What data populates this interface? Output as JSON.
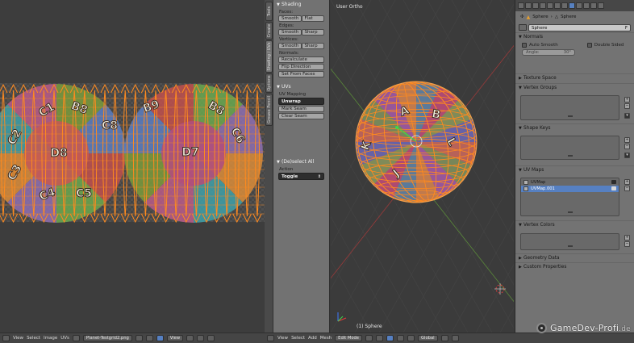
{
  "uv_editor": {
    "labels": [
      "C1",
      "B8",
      "C2",
      "D8",
      "C3",
      "C4",
      "C5",
      "C8",
      "B9",
      "D7",
      "B8",
      "C6"
    ],
    "header": {
      "menus": [
        "View",
        "Select",
        "Image",
        "UVs"
      ],
      "image_name": "Planet-Testgrid2.png",
      "view_label": "View"
    }
  },
  "tool_tabs": [
    "Tools",
    "Create",
    "Shading / UVs",
    "Options",
    "Grease Pencil"
  ],
  "tool_shelf": {
    "shading": {
      "title": "Shading",
      "faces_label": "Faces:",
      "faces_buttons": [
        "Smooth",
        "Flat"
      ],
      "edges_label": "Edges:",
      "edges_buttons": [
        "Smooth",
        "Sharp"
      ],
      "vertices_label": "Vertices:",
      "vertices_buttons": [
        "Smooth",
        "Sharp"
      ],
      "normals_label": "Normals:",
      "normals_buttons": [
        "Recalculate",
        "Flip Direction",
        "Set From Faces"
      ]
    },
    "uvs": {
      "title": "UVs",
      "mapping_label": "UV Mapping",
      "unwrap_label": "Unwrap",
      "buttons": [
        "Mark Seam",
        "Clear Seam"
      ]
    },
    "deselect": {
      "title": "(De)select All",
      "action_label": "Action",
      "action_value": "Toggle"
    }
  },
  "viewport": {
    "view_label": "User Ortho",
    "object_label": "(1) Sphere",
    "sphere_labels": [
      "A",
      "B",
      "K",
      "J",
      "L"
    ],
    "header": {
      "menus": [
        "View",
        "Select",
        "Add",
        "Mesh"
      ],
      "mode": "Edit Mode",
      "orientation": "Global"
    }
  },
  "properties": {
    "breadcrumb": [
      "Sphere",
      "Sphere"
    ],
    "mesh_name": "Sphere",
    "mesh_name_suffix": "F",
    "normals": {
      "title": "Normals",
      "auto_smooth": "Auto Smooth",
      "double_sided": "Double Sided",
      "angle_label": "Angle:",
      "angle_value": "30°"
    },
    "sections": {
      "texture_space": "Texture Space",
      "vertex_groups": "Vertex Groups",
      "shape_keys": "Shape Keys",
      "uv_maps": "UV Maps",
      "vertex_colors": "Vertex Colors",
      "geometry_data": "Geometry Data",
      "custom_properties": "Custom Properties"
    },
    "uv_maps": [
      "UVMap",
      "UVMap.001"
    ]
  },
  "watermark": {
    "text": "GameDev-Profi",
    "suffix": ".de"
  },
  "colors": {
    "uv_edge": "#ff8a1e",
    "selected_row": "#5680c2",
    "panel_bg": "#737373"
  }
}
